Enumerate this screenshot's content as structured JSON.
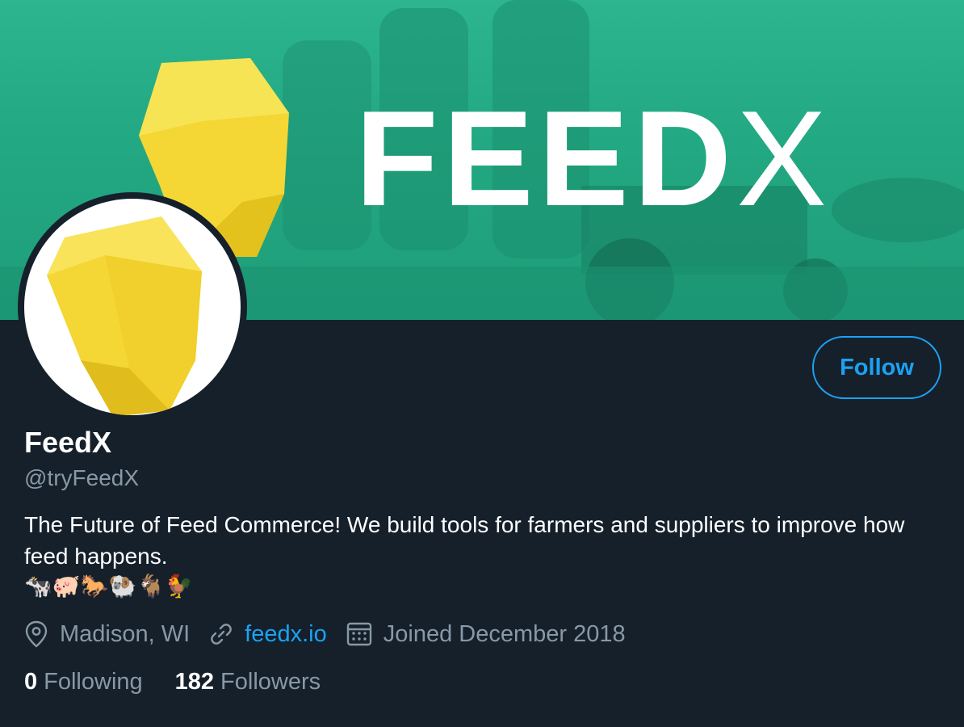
{
  "profile": {
    "display_name": "FeedX",
    "handle": "@tryFeedX",
    "bio": "The Future of Feed Commerce! We build tools for farmers and suppliers to improve how feed happens.",
    "bio_emojis": "🐄🐖🐎🐏🐐🐓",
    "location": "Madison, WI",
    "website": "feedx.io",
    "joined": "Joined December 2018"
  },
  "banner": {
    "brand_main": "FEED",
    "brand_x": "X"
  },
  "actions": {
    "follow_label": "Follow"
  },
  "stats": {
    "following_count": "0",
    "following_label": "Following",
    "followers_count": "182",
    "followers_label": "Followers"
  },
  "icons": {
    "location": "location-pin-icon",
    "link": "link-icon",
    "calendar": "calendar-icon"
  },
  "colors": {
    "background": "#15202b",
    "accent": "#1da1f2",
    "secondary_text": "#8899a6",
    "banner_green": "#22a882",
    "brand_yellow": "#f5d834"
  }
}
